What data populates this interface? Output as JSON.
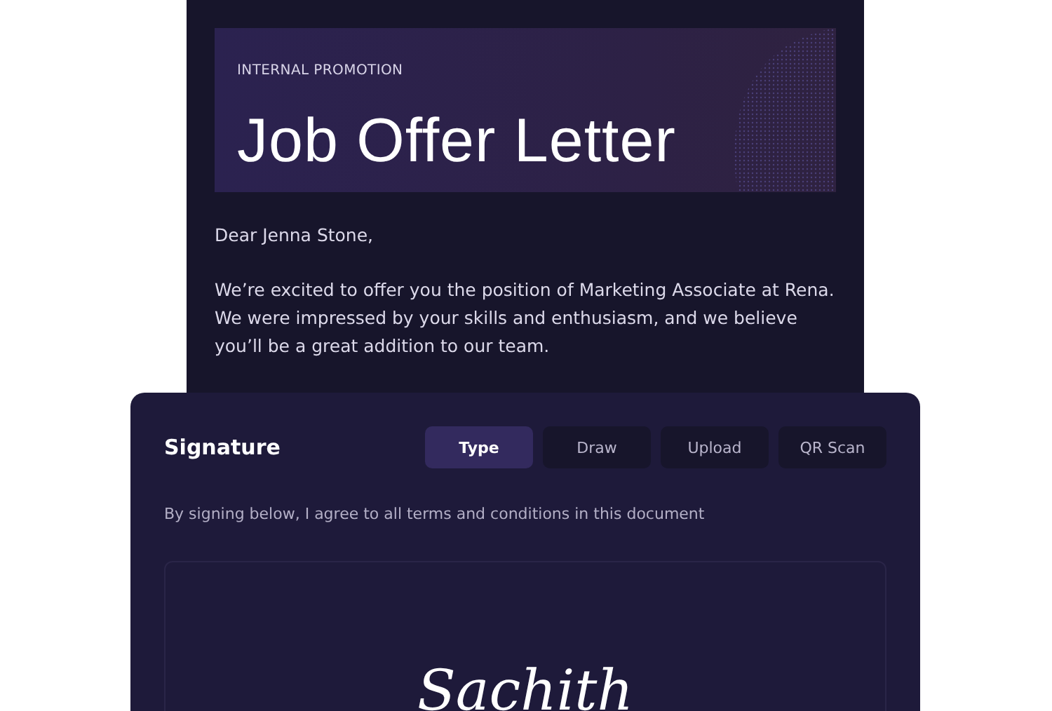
{
  "letter": {
    "eyebrow": "INTERNAL PROMOTION",
    "title": "Job Offer Letter",
    "greeting": "Dear Jenna Stone,",
    "body": "We’re excited to offer you the position of Marketing Associate at Rena. We were impressed by your skills and enthusiasm, and we believe you’ll be a great addition to our team."
  },
  "signature": {
    "title": "Signature",
    "tabs": [
      {
        "label": "Type",
        "selected": true
      },
      {
        "label": "Draw",
        "selected": false
      },
      {
        "label": "Upload",
        "selected": false
      },
      {
        "label": "QR Scan",
        "selected": false
      }
    ],
    "agreement": "By signing below, I agree to all terms and conditions in this document",
    "value": "Sachith"
  }
}
